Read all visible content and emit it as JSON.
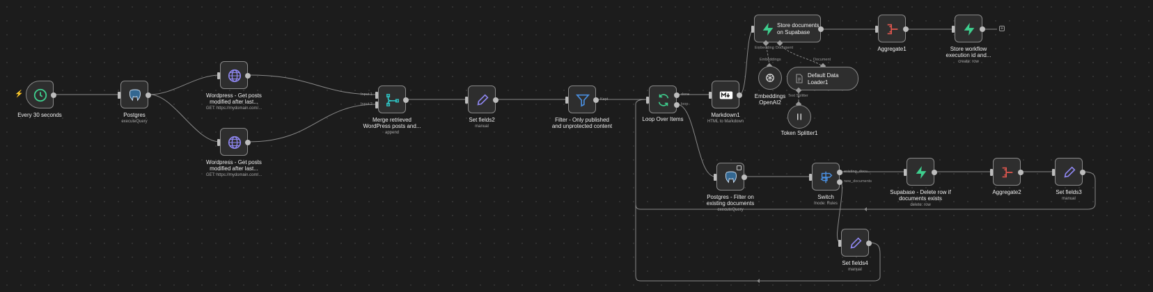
{
  "nodes": {
    "trigger": {
      "label": "Every 30 seconds"
    },
    "postgres": {
      "label": "Postgres",
      "sub": "executeQuery"
    },
    "wp1": {
      "label_line1": "Wordpress - Get posts",
      "label_line2": "modified after last...",
      "sub": "GET: https://mydomain.com/..."
    },
    "wp2": {
      "label_line1": "Wordpress - Get posts",
      "label_line2": "modified after last...",
      "sub": "GET: https://mydomain.com/..."
    },
    "merge": {
      "label_line1": "Merge retrieved",
      "label_line2": "WordPress posts and...",
      "sub": "append",
      "input1": "Input 1",
      "input2": "Input 2"
    },
    "setfields2": {
      "label": "Set fields2",
      "sub": "manual"
    },
    "filter": {
      "label_line1": "Filter - Only published",
      "label_line2": "and unprotected content",
      "port": "Kept"
    },
    "loop": {
      "label": "Loop Over Items",
      "port_done": "done",
      "port_loop": "loop"
    },
    "markdown": {
      "label": "Markdown1",
      "sub": "HTML to Markdown"
    },
    "supabase_store": {
      "label_line1": "Store documents",
      "label_line2": "on Supabase",
      "port_embed": "Embedding",
      "port_doc": "Document"
    },
    "embeddings": {
      "label_line1": "Embeddings",
      "label_line2": "OpenAI2",
      "port": "Embeddings"
    },
    "loader": {
      "label_line1": "Default Data",
      "label_line2": "Loader1",
      "port_doc": "Document",
      "port_split": "Text Splitter"
    },
    "splitter": {
      "label": "Token Splitter1"
    },
    "aggregate1": {
      "label": "Aggregate1"
    },
    "store_wf": {
      "label_line1": "Store workflow",
      "label_line2": "execution id and...",
      "sub": "create: row"
    },
    "pg_filter": {
      "label_line1": "Postgres - Filter on",
      "label_line2": "existing documents",
      "sub": "executeQuery"
    },
    "switch": {
      "label": "Switch",
      "sub": "mode: Rules",
      "port_existing": "existing_docu...",
      "port_new": "new_documents"
    },
    "supabase_delete": {
      "label_line1": "Supabase - Delete row if",
      "label_line2": "documents exists",
      "sub": "delete: row"
    },
    "aggregate2": {
      "label": "Aggregate2"
    },
    "setfields3": {
      "label": "Set fields3",
      "sub": "manual"
    },
    "setfields4": {
      "label": "Set fields4",
      "sub": "manual"
    }
  },
  "icons": {
    "trigger": "clock-icon",
    "postgres": "elephant-icon",
    "wordpress": "globe-icon",
    "merge": "merge-icon",
    "set": "pencil-icon",
    "filter": "funnel-icon",
    "loop": "refresh-icon",
    "markdown": "markdown-icon",
    "supabase": "bolt-icon",
    "aggregate": "aggregate-icon",
    "openai": "openai-icon",
    "loader": "document-icon",
    "splitter": "pause-icon",
    "switch": "signpost-icon"
  },
  "colors": {
    "canvas": "#1c1c1c",
    "node_bg": "#2e2e2e",
    "edge": "#8a8a8a",
    "accent_green": "#3ecf8e",
    "accent_red": "#e0574f",
    "accent_purple": "#8f87f1",
    "accent_blue": "#4a90e2",
    "accent_teal": "#2ec4c4"
  }
}
